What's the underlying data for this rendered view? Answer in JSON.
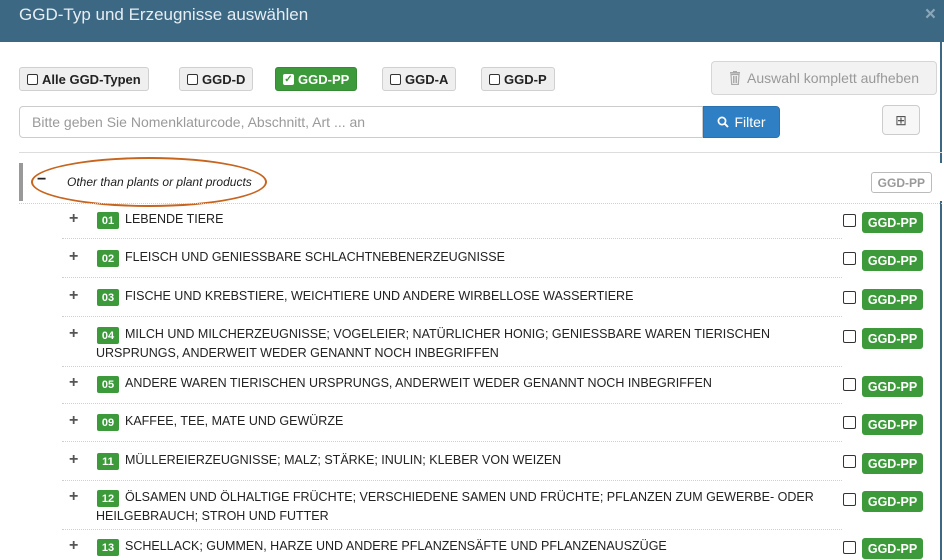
{
  "dialog": {
    "title": "GGD-Typ und Erzeugnisse auswählen",
    "close_glyph": "×"
  },
  "type_filters": [
    {
      "label": "Alle GGD-Typen",
      "checked": false
    },
    {
      "label": "GGD-D",
      "checked": false
    },
    {
      "label": "GGD-PP",
      "checked": true
    },
    {
      "label": "GGD-A",
      "checked": false
    },
    {
      "label": "GGD-P",
      "checked": false
    }
  ],
  "clear_button": {
    "label": "Auswahl komplett aufheben",
    "icon": "trash-icon"
  },
  "search": {
    "placeholder": "Bitte geben Sie Nomenklaturcode, Abschnitt, Art ... an",
    "value": ""
  },
  "filter_button": {
    "label": "Filter",
    "icon": "search-icon"
  },
  "expand_all_button": {
    "glyph": "⊞"
  },
  "section": {
    "toggle": "−",
    "label": "Other than plants or plant products",
    "badge": "GGD-PP"
  },
  "rows": [
    {
      "code": "01",
      "text": "LEBENDE TIERE",
      "badge": "GGD-PP",
      "checked": false
    },
    {
      "code": "02",
      "text": "FLEISCH UND GENIESSBARE SCHLACHTNEBENERZEUGNISSE",
      "badge": "GGD-PP",
      "checked": false
    },
    {
      "code": "03",
      "text": "FISCHE UND KREBSTIERE, WEICHTIERE UND ANDERE WIRBELLOSE WASSERTIERE",
      "badge": "GGD-PP",
      "checked": false
    },
    {
      "code": "04",
      "text": "MILCH UND MILCHERZEUGNISSE; VOGELEIER; NATÜRLICHER HONIG; GENIESSBARE WAREN TIERISCHEN URSPRUNGS, ANDERWEIT WEDER GENANNT NOCH INBEGRIFFEN",
      "badge": "GGD-PP",
      "checked": false
    },
    {
      "code": "05",
      "text": "ANDERE WAREN TIERISCHEN URSPRUNGS, ANDERWEIT WEDER GENANNT NOCH INBEGRIFFEN",
      "badge": "GGD-PP",
      "checked": false
    },
    {
      "code": "09",
      "text": "KAFFEE, TEE, MATE UND GEWÜRZE",
      "badge": "GGD-PP",
      "checked": false
    },
    {
      "code": "11",
      "text": "MÜLLEREIERZEUGNISSE; MALZ; STÄRKE; INULIN; KLEBER VON WEIZEN",
      "badge": "GGD-PP",
      "checked": false
    },
    {
      "code": "12",
      "text": "ÖLSAMEN UND ÖLHALTIGE FRÜCHTE; VERSCHIEDENE SAMEN UND FRÜCHTE; PFLANZEN ZUM GEWERBE- ODER HEILGEBRAUCH; STROH UND FUTTER",
      "badge": "GGD-PP",
      "checked": false
    },
    {
      "code": "13",
      "text": "SCHELLACK; GUMMEN, HARZE UND ANDERE PFLANZENSÄFTE UND PFLANZENAUSZÜGE",
      "badge": "GGD-PP",
      "checked": false
    }
  ],
  "colors": {
    "header": "#3d6883",
    "green": "#3c9a3a",
    "blue": "#2f7fc5",
    "annotation": "#c7641e"
  }
}
